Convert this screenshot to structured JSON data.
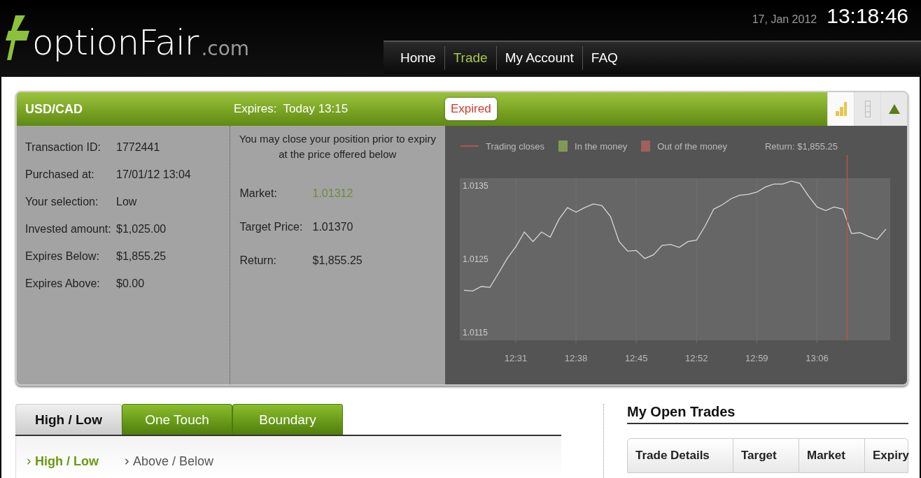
{
  "header": {
    "logo": {
      "name": "optionFair",
      "suffix": ".com"
    },
    "date": "17, Jan 2012",
    "time": "13:18:46"
  },
  "nav": [
    {
      "label": "Home",
      "selected": false
    },
    {
      "label": "Trade",
      "selected": true
    },
    {
      "label": "My Account",
      "selected": false
    },
    {
      "label": "FAQ",
      "selected": false
    }
  ],
  "trade_panel": {
    "pair": "USD/CAD",
    "expires": "Expires:  Today 13:15",
    "status": "Expired",
    "view_buttons": [
      {
        "kind": "chart",
        "selected": true
      },
      {
        "kind": "list",
        "selected": false
      },
      {
        "kind": "triangle",
        "selected": false
      }
    ],
    "details": [
      {
        "label": "Transaction ID:",
        "value": "1772441"
      },
      {
        "label": "Purchased at:",
        "value": "17/01/12 13:04"
      },
      {
        "label": "Your selection:",
        "value": "Low"
      },
      {
        "label": "Invested amount:",
        "value": "$1,025.00"
      },
      {
        "label": "Expires Below:",
        "value": "$1,855.25"
      },
      {
        "label": "Expires Above:",
        "value": "$0.00"
      }
    ],
    "close_note": "You may close your position prior to expiry at the price offered below",
    "close_rows": [
      {
        "label": "Market:",
        "value": "1.01312",
        "highlight": true
      },
      {
        "label": "Target Price:",
        "value": "1.01370",
        "highlight": false
      },
      {
        "label": "Return:",
        "value": "$1,855.25",
        "highlight": false
      }
    ],
    "legend": [
      {
        "kind": "line",
        "label": "Trading closes",
        "color": "#b5544a"
      },
      {
        "kind": "square",
        "label": "In the money",
        "color": "#7f9a57"
      },
      {
        "kind": "square",
        "label": "Out of the money",
        "color": "#a0605c"
      }
    ],
    "return": "Return: $1,855.25",
    "chart_data": {
      "type": "line",
      "categories": [
        null,
        null,
        null,
        null,
        null,
        null,
        "12:31",
        null,
        null,
        null,
        null,
        null,
        null,
        "12:38",
        null,
        null,
        null,
        null,
        null,
        null,
        "12:45",
        null,
        null,
        null,
        null,
        null,
        null,
        "12:52",
        null,
        null,
        null,
        null,
        null,
        null,
        "12:59",
        null,
        null,
        null,
        null,
        null,
        null,
        "13:06",
        null,
        null,
        null,
        null,
        null,
        null,
        null,
        null
      ],
      "series": [
        {
          "color": "#d8d8d8",
          "values": [
            1.01208,
            1.01207,
            1.01213,
            1.01212,
            1.01231,
            1.01251,
            1.01267,
            1.01287,
            1.01274,
            1.01287,
            1.0128,
            1.01304,
            1.0132,
            1.01314,
            1.0132,
            1.01325,
            1.01323,
            1.01308,
            1.01274,
            1.01261,
            1.01262,
            1.01251,
            1.01256,
            1.01269,
            1.0127,
            1.01266,
            1.01274,
            1.01276,
            1.01295,
            1.01318,
            1.01324,
            1.01332,
            1.01337,
            1.01338,
            1.01341,
            1.01348,
            1.01352,
            1.01352,
            1.01356,
            1.01353,
            1.01336,
            1.01321,
            1.01316,
            1.01321,
            1.01318,
            1.01285,
            1.01286,
            1.01281,
            1.01277,
            1.01291
          ]
        }
      ],
      "ylim": [
        1.0114,
        1.0136
      ],
      "yticks": [
        1.0115,
        1.0125,
        1.0135
      ],
      "grid": true
    }
  },
  "trade_types": [
    {
      "label": "High / Low",
      "selected": true
    },
    {
      "label": "One Touch",
      "selected": false
    },
    {
      "label": "Boundary",
      "selected": false
    }
  ],
  "sub_types": [
    {
      "label": "High / Low",
      "selected": true
    },
    {
      "label": "Above / Below",
      "selected": false
    }
  ],
  "open_trades": {
    "title": "My Open Trades",
    "columns": [
      "Trade Details",
      "Target",
      "Market",
      "Expiry"
    ]
  }
}
